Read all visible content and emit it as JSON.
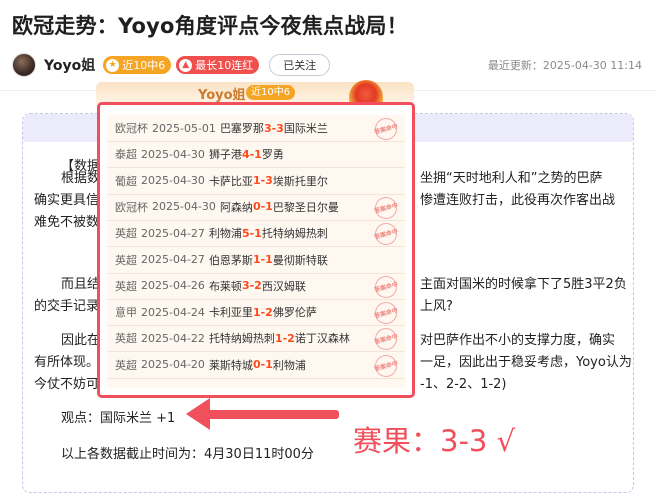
{
  "article": {
    "title": "欧冠走势：Yoyo角度评点今夜焦点战局！",
    "author": "Yoyo姐",
    "badge_streak": "近10中6",
    "badge_hot": "最长10连红",
    "follow_label": "已关注",
    "updated_label": "最近更新：",
    "updated_time": "2025-04-30 11:14"
  },
  "body": {
    "para0": "【数据",
    "para1a": "根据数",
    "para1b": "坐拥“天时地利人和”之势的巴萨",
    "para2a": "确实更具信",
    "para2b": "惨遭连败打击，此役再次作客出战",
    "para3": "难免不被数",
    "para4a": "而且结",
    "para4b": "主面对国米的时候拿下了5胜3平2负",
    "para5a": "的交手记录",
    "para5b": "上风?",
    "para6a": "因此在",
    "para6b": "对巴萨作出不小的支撑力度，确实",
    "para7a": "有所体现。",
    "para7b": "一足，因此出于稳妥考虑，Yoyo认为",
    "para8a": "今仗不妨可",
    "para8b": "-1、2-2、1-2)",
    "viewpoint": "观点：国际米兰 +1",
    "data_note": "以上各数据截止时间为：4月30日11时00分"
  },
  "popup": {
    "header_name": "Yoyo姐",
    "header_badge": "近10中6",
    "stamp_text": "答案命中",
    "rows": [
      {
        "league": "欧冠杯",
        "date": "2025-05-01",
        "home": "巴塞罗那",
        "hs": "3",
        "sep": " - ",
        "as": "3",
        "away": "国际米兰",
        "hit": true
      },
      {
        "league": "泰超",
        "date": "2025-04-30",
        "home": "狮子港",
        "hs": "4",
        "sep": " - ",
        "as": "1",
        "away": "罗勇",
        "hit": false
      },
      {
        "league": "葡超",
        "date": "2025-04-30",
        "home": "卡萨比亚",
        "hs": "1",
        "sep": " - ",
        "as": "3",
        "away": "埃斯托里尔",
        "hit": false
      },
      {
        "league": "欧冠杯",
        "date": "2025-04-30",
        "home": "阿森纳",
        "hs": "0",
        "sep": " - ",
        "as": "1",
        "away": "巴黎圣日尔曼",
        "hit": true
      },
      {
        "league": "英超",
        "date": "2025-04-27",
        "home": "利物浦",
        "hs": "5",
        "sep": " - ",
        "as": "1",
        "away": "托特纳姆热刺",
        "hit": true
      },
      {
        "league": "英超",
        "date": "2025-04-27",
        "home": "伯恩茅斯",
        "hs": "1",
        "sep": " - ",
        "as": "1",
        "away": "曼彻斯特联",
        "hit": false
      },
      {
        "league": "英超",
        "date": "2025-04-26",
        "home": "布莱顿",
        "hs": "3",
        "sep": " - ",
        "as": "2",
        "away": "西汉姆联",
        "hit": true
      },
      {
        "league": "意甲",
        "date": "2025-04-24",
        "home": "卡利亚里",
        "hs": "1",
        "sep": " - ",
        "as": "2",
        "away": "佛罗伦萨",
        "hit": true
      },
      {
        "league": "英超",
        "date": "2025-04-22",
        "home": "托特纳姆热刺",
        "hs": "1",
        "sep": " - ",
        "as": "2",
        "away": "诺丁汉森林",
        "hit": true
      },
      {
        "league": "英超",
        "date": "2025-04-20",
        "home": "莱斯特城",
        "hs": "0",
        "sep": " - ",
        "as": "1",
        "away": "利物浦",
        "hit": true
      }
    ]
  },
  "annotation": {
    "result_text": "赛果：3-3 √"
  },
  "colors": {
    "accent_red": "#f0505c",
    "score": "#ff4a1a",
    "badge_orange": "#f5a524"
  }
}
